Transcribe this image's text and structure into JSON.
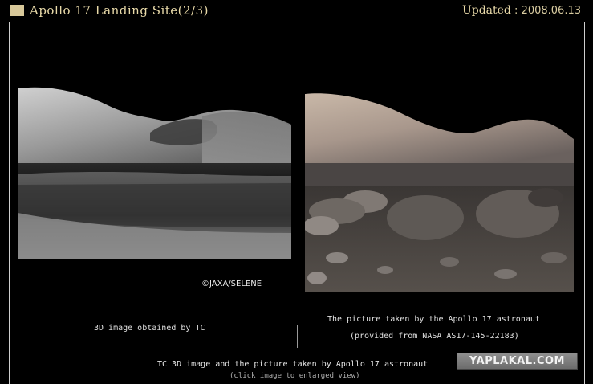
{
  "header": {
    "title": "Apollo 17 Landing Site(2/3)",
    "updated_label": "Updated",
    "updated_sep": " : ",
    "updated_date": "2008.06.13",
    "swatch_color": "#d8c89a",
    "text_color": "#e8d9a8"
  },
  "left_panel": {
    "credit": "©JAXA/SELENE",
    "caption": "3D image obtained by TC"
  },
  "right_panel": {
    "caption_line1": "The picture taken by the Apollo 17 astronaut",
    "caption_line2": "(provided from NASA AS17-145-22183)"
  },
  "footer": {
    "caption": "TC 3D image and the picture taken by Apollo 17 astronaut",
    "hint": "(click image to enlarged view)"
  },
  "watermark": "YAPLAKAL.COM"
}
